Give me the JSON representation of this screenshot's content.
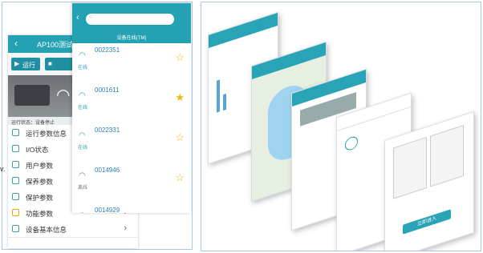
{
  "back_phone": {
    "title": "AP100测试",
    "run_button": "运行",
    "status_text": "运行状态：设备停止",
    "menu": [
      {
        "label": "运行参数信息",
        "icon": "monitor-icon",
        "show_chevron": false
      },
      {
        "label": "I/O状态",
        "icon": "io-icon",
        "show_chevron": false
      },
      {
        "label": "用户参数",
        "icon": "user-icon",
        "show_chevron": false
      },
      {
        "label": "保养参数",
        "icon": "wrench-icon",
        "show_chevron": false
      },
      {
        "label": "保护参数",
        "icon": "shield-icon",
        "show_chevron": false
      },
      {
        "label": "功能参数",
        "icon": "function-icon",
        "show_chevron": true
      },
      {
        "label": "设备基本信息",
        "icon": "info-icon",
        "show_chevron": true
      }
    ]
  },
  "front_phone": {
    "search_placeholder": "",
    "subtitle": "设备在线(TM)",
    "devices": [
      {
        "id": "0022351",
        "online_label": "在线",
        "star_filled": false
      },
      {
        "id": "0001611",
        "online_label": "在线",
        "star_filled": true
      },
      {
        "id": "0022331",
        "online_label": "在线",
        "star_filled": false
      },
      {
        "id": "0014946",
        "online_label": "离线",
        "star_filled": false
      },
      {
        "id": "0014929",
        "online_label": "",
        "star_filled": false
      }
    ]
  },
  "left_marker": "v.",
  "right_panel": {
    "enter_button": "立即进入",
    "cards": [
      "card-chart",
      "card-map",
      "card-3d",
      "card-list",
      "card-welcome"
    ]
  },
  "colors": {
    "accent": "#24a2b3",
    "star": "#f2b705",
    "frame_border": "#a9c8e6"
  }
}
